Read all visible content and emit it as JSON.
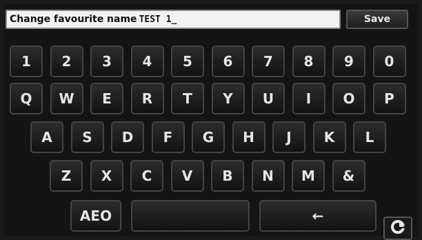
{
  "header": {
    "label": "Change favourite name",
    "value": "TEST 1_",
    "save_label": "Save"
  },
  "keyboard": {
    "row1": [
      "1",
      "2",
      "3",
      "4",
      "5",
      "6",
      "7",
      "8",
      "9",
      "0"
    ],
    "row2": [
      "Q",
      "W",
      "E",
      "R",
      "T",
      "Y",
      "U",
      "I",
      "O",
      "P"
    ],
    "row3": [
      "A",
      "S",
      "D",
      "F",
      "G",
      "H",
      "J",
      "K",
      "L"
    ],
    "row4": [
      "Z",
      "X",
      "C",
      "V",
      "B",
      "N",
      "M",
      "&"
    ],
    "aeo_label": "AEO",
    "backspace_label": "←"
  },
  "icons": {
    "corner": "refresh-icon"
  }
}
